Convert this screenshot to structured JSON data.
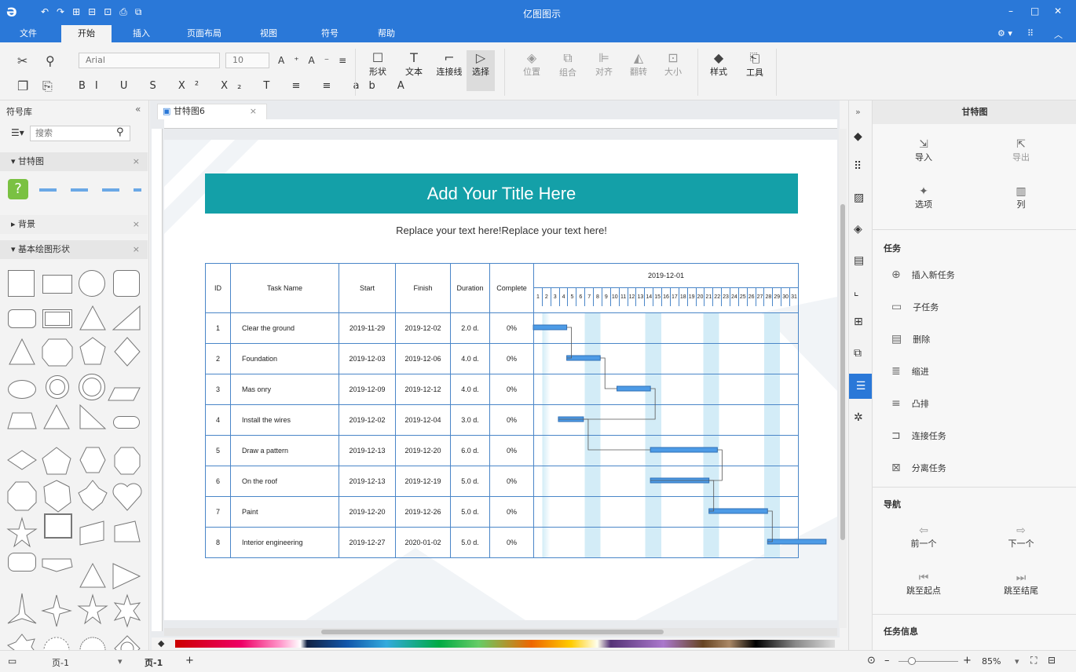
{
  "app": {
    "title": "亿图图示"
  },
  "menu": {
    "tabs": [
      "文件",
      "开始",
      "插入",
      "页面布局",
      "视图",
      "符号",
      "帮助"
    ],
    "active": "开始"
  },
  "ribbon": {
    "font": "Arial",
    "size": "10",
    "tools": [
      {
        "label": "形状"
      },
      {
        "label": "文本"
      },
      {
        "label": "连接线"
      },
      {
        "label": "选择"
      }
    ],
    "arrange": [
      {
        "label": "位置"
      },
      {
        "label": "组合"
      },
      {
        "label": "对齐"
      },
      {
        "label": "翻转"
      },
      {
        "label": "大小"
      }
    ],
    "style_label": "样式",
    "tool_label": "工具"
  },
  "left": {
    "title": "符号库",
    "search_placeholder": "搜索",
    "sections": [
      "甘特图",
      "背景",
      "基本绘图形状"
    ]
  },
  "doc": {
    "tab": "甘特图6"
  },
  "diagram": {
    "title": "Add Your Title Here",
    "subtitle": "Replace your text here!Replace your text here!",
    "headers": {
      "id": "ID",
      "name": "Task Name",
      "start": "Start",
      "finish": "Finish",
      "duration": "Duration",
      "complete": "Complete",
      "month": "2019-12-01"
    },
    "rows": [
      {
        "id": "1",
        "name": "Clear the ground",
        "start": "2019-11-29",
        "finish": "2019-12-02",
        "duration": "2.0 d.",
        "complete": "0%"
      },
      {
        "id": "2",
        "name": "Foundation",
        "start": "2019-12-03",
        "finish": "2019-12-06",
        "duration": "4.0 d.",
        "complete": "0%"
      },
      {
        "id": "3",
        "name": "Mas onry",
        "start": "2019-12-09",
        "finish": "2019-12-12",
        "duration": "4.0 d.",
        "complete": "0%"
      },
      {
        "id": "4",
        "name": "Install the wires",
        "start": "2019-12-02",
        "finish": "2019-12-04",
        "duration": "3.0 d.",
        "complete": "0%"
      },
      {
        "id": "5",
        "name": "Draw a pattern",
        "start": "2019-12-13",
        "finish": "2019-12-20",
        "duration": "6.0 d.",
        "complete": "0%"
      },
      {
        "id": "6",
        "name": "On the roof",
        "start": "2019-12-13",
        "finish": "2019-12-19",
        "duration": "5.0 d.",
        "complete": "0%"
      },
      {
        "id": "7",
        "name": "Paint",
        "start": "2019-12-20",
        "finish": "2019-12-26",
        "duration": "5.0 d.",
        "complete": "0%"
      },
      {
        "id": "8",
        "name": "Interior engineering",
        "start": "2019-12-27",
        "finish": "2020-01-02",
        "duration": "5.0 d.",
        "complete": "0%"
      }
    ]
  },
  "right": {
    "title": "甘特图",
    "top": [
      {
        "label": "导入"
      },
      {
        "label": "导出"
      },
      {
        "label": "选项"
      },
      {
        "label": "列"
      }
    ],
    "task_title": "任务",
    "tasks": [
      "插入新任务",
      "子任务",
      "删除",
      "缩进",
      "凸排",
      "连接任务",
      "分离任务"
    ],
    "nav_title": "导航",
    "nav": [
      "前一个",
      "下一个",
      "跳至起点",
      "跳至结尾"
    ],
    "info_title": "任务信息"
  },
  "status": {
    "page_dropdown": "页-1",
    "page_tab": "页-1",
    "zoom": "85%"
  }
}
